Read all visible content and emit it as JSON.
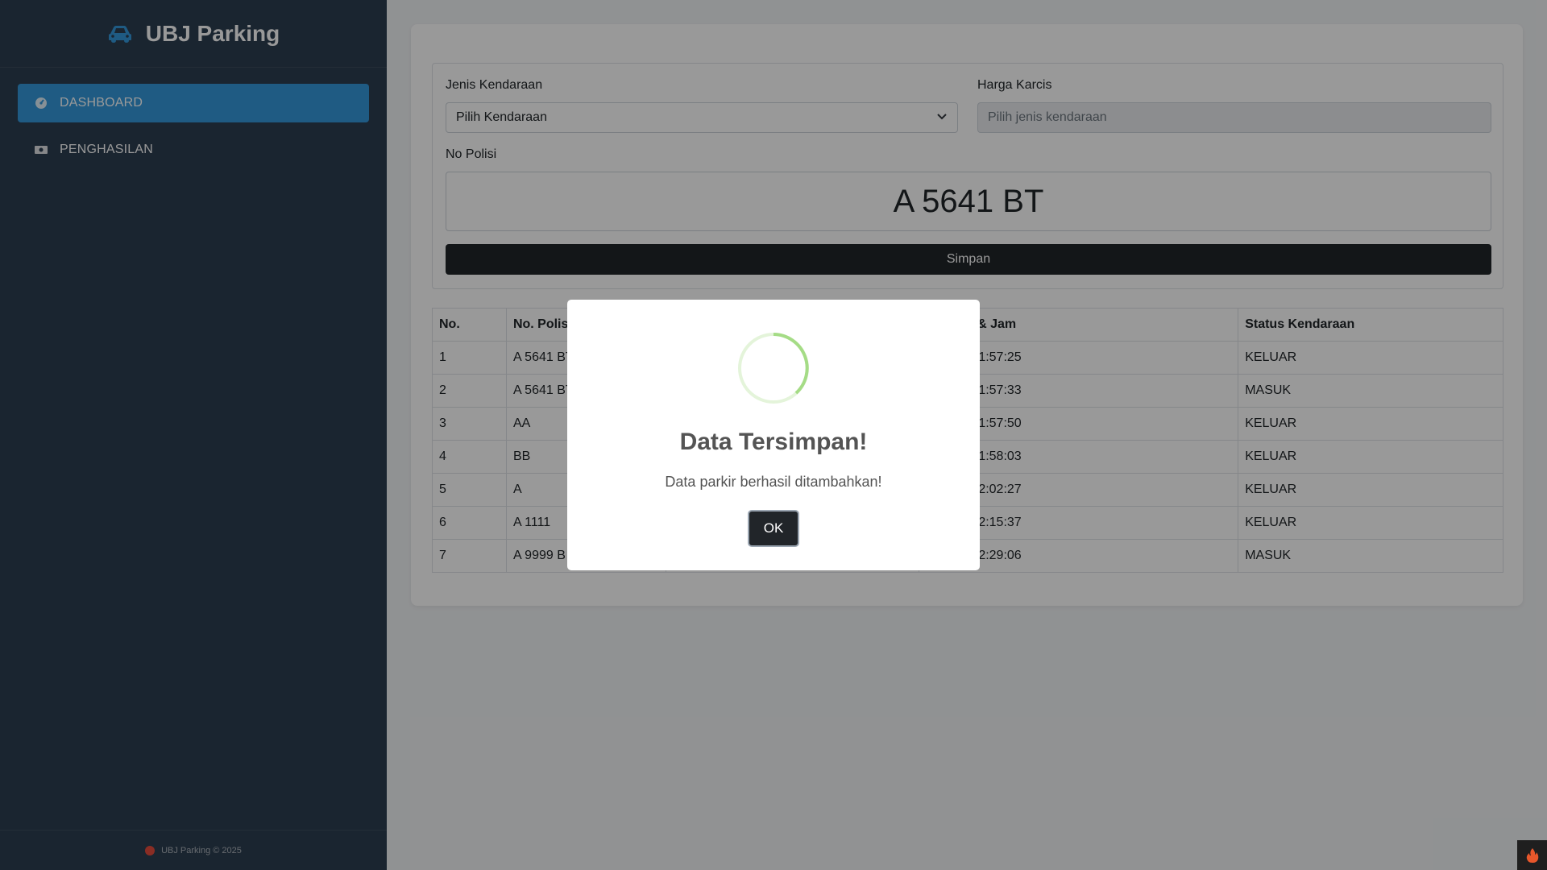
{
  "app": {
    "title": "UBJ Parking",
    "accent": "#3498db",
    "sidebar_bg": "#2c3e50"
  },
  "sidebar": {
    "items": [
      {
        "label": "DASHBOARD",
        "icon": "tachometer-icon",
        "active": true
      },
      {
        "label": "PENGHASILAN",
        "icon": "money-bill-icon",
        "active": false
      }
    ],
    "footer": "UBJ Parking © 2025"
  },
  "form": {
    "vehicle_label": "Jenis Kendaraan",
    "vehicle_selected": "Pilih Kendaraan",
    "price_label": "Harga Karcis",
    "price_placeholder": "Pilih jenis kendaraan",
    "plate_label": "No Polisi",
    "plate_value": "A 5641 BT",
    "save_label": "Simpan"
  },
  "table": {
    "headers": [
      "No.",
      "No. Polisi",
      "",
      "Tanggal & Jam",
      "Status Kendaraan"
    ],
    "rows": [
      [
        "1",
        "A 5641 BT",
        "",
        "…025 - 01:57:25",
        "KELUAR"
      ],
      [
        "2",
        "A 5641 BT",
        "",
        "…025 - 01:57:33",
        "MASUK"
      ],
      [
        "3",
        "AA",
        "",
        "…025 - 01:57:50",
        "KELUAR"
      ],
      [
        "4",
        "BB",
        "",
        "…025 - 01:58:03",
        "KELUAR"
      ],
      [
        "5",
        "A",
        "",
        "…025 - 02:02:27",
        "KELUAR"
      ],
      [
        "6",
        "A 1111",
        "",
        "…025 - 02:15:37",
        "KELUAR"
      ],
      [
        "7",
        "A 9999 B",
        "",
        "…025 - 02:29:06",
        "MASUK"
      ]
    ]
  },
  "modal": {
    "title": "Data Tersimpan!",
    "message": "Data parkir berhasil ditambahkan!",
    "ok_label": "OK",
    "icon": "success-spinner-icon",
    "icon_color": "#a5dc86"
  }
}
